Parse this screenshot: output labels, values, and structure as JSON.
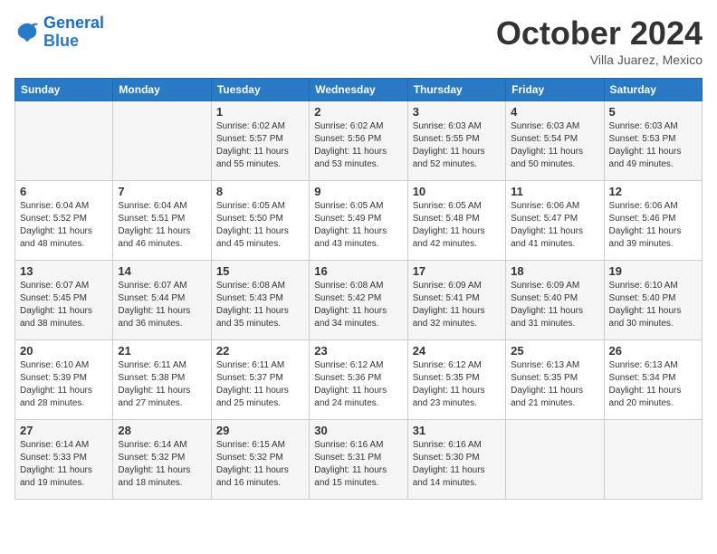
{
  "header": {
    "logo_line1": "General",
    "logo_line2": "Blue",
    "month": "October 2024",
    "location": "Villa Juarez, Mexico"
  },
  "weekdays": [
    "Sunday",
    "Monday",
    "Tuesday",
    "Wednesday",
    "Thursday",
    "Friday",
    "Saturday"
  ],
  "weeks": [
    [
      {
        "day": "",
        "info": ""
      },
      {
        "day": "",
        "info": ""
      },
      {
        "day": "1",
        "info": "Sunrise: 6:02 AM\nSunset: 5:57 PM\nDaylight: 11 hours\nand 55 minutes."
      },
      {
        "day": "2",
        "info": "Sunrise: 6:02 AM\nSunset: 5:56 PM\nDaylight: 11 hours\nand 53 minutes."
      },
      {
        "day": "3",
        "info": "Sunrise: 6:03 AM\nSunset: 5:55 PM\nDaylight: 11 hours\nand 52 minutes."
      },
      {
        "day": "4",
        "info": "Sunrise: 6:03 AM\nSunset: 5:54 PM\nDaylight: 11 hours\nand 50 minutes."
      },
      {
        "day": "5",
        "info": "Sunrise: 6:03 AM\nSunset: 5:53 PM\nDaylight: 11 hours\nand 49 minutes."
      }
    ],
    [
      {
        "day": "6",
        "info": "Sunrise: 6:04 AM\nSunset: 5:52 PM\nDaylight: 11 hours\nand 48 minutes."
      },
      {
        "day": "7",
        "info": "Sunrise: 6:04 AM\nSunset: 5:51 PM\nDaylight: 11 hours\nand 46 minutes."
      },
      {
        "day": "8",
        "info": "Sunrise: 6:05 AM\nSunset: 5:50 PM\nDaylight: 11 hours\nand 45 minutes."
      },
      {
        "day": "9",
        "info": "Sunrise: 6:05 AM\nSunset: 5:49 PM\nDaylight: 11 hours\nand 43 minutes."
      },
      {
        "day": "10",
        "info": "Sunrise: 6:05 AM\nSunset: 5:48 PM\nDaylight: 11 hours\nand 42 minutes."
      },
      {
        "day": "11",
        "info": "Sunrise: 6:06 AM\nSunset: 5:47 PM\nDaylight: 11 hours\nand 41 minutes."
      },
      {
        "day": "12",
        "info": "Sunrise: 6:06 AM\nSunset: 5:46 PM\nDaylight: 11 hours\nand 39 minutes."
      }
    ],
    [
      {
        "day": "13",
        "info": "Sunrise: 6:07 AM\nSunset: 5:45 PM\nDaylight: 11 hours\nand 38 minutes."
      },
      {
        "day": "14",
        "info": "Sunrise: 6:07 AM\nSunset: 5:44 PM\nDaylight: 11 hours\nand 36 minutes."
      },
      {
        "day": "15",
        "info": "Sunrise: 6:08 AM\nSunset: 5:43 PM\nDaylight: 11 hours\nand 35 minutes."
      },
      {
        "day": "16",
        "info": "Sunrise: 6:08 AM\nSunset: 5:42 PM\nDaylight: 11 hours\nand 34 minutes."
      },
      {
        "day": "17",
        "info": "Sunrise: 6:09 AM\nSunset: 5:41 PM\nDaylight: 11 hours\nand 32 minutes."
      },
      {
        "day": "18",
        "info": "Sunrise: 6:09 AM\nSunset: 5:40 PM\nDaylight: 11 hours\nand 31 minutes."
      },
      {
        "day": "19",
        "info": "Sunrise: 6:10 AM\nSunset: 5:40 PM\nDaylight: 11 hours\nand 30 minutes."
      }
    ],
    [
      {
        "day": "20",
        "info": "Sunrise: 6:10 AM\nSunset: 5:39 PM\nDaylight: 11 hours\nand 28 minutes."
      },
      {
        "day": "21",
        "info": "Sunrise: 6:11 AM\nSunset: 5:38 PM\nDaylight: 11 hours\nand 27 minutes."
      },
      {
        "day": "22",
        "info": "Sunrise: 6:11 AM\nSunset: 5:37 PM\nDaylight: 11 hours\nand 25 minutes."
      },
      {
        "day": "23",
        "info": "Sunrise: 6:12 AM\nSunset: 5:36 PM\nDaylight: 11 hours\nand 24 minutes."
      },
      {
        "day": "24",
        "info": "Sunrise: 6:12 AM\nSunset: 5:35 PM\nDaylight: 11 hours\nand 23 minutes."
      },
      {
        "day": "25",
        "info": "Sunrise: 6:13 AM\nSunset: 5:35 PM\nDaylight: 11 hours\nand 21 minutes."
      },
      {
        "day": "26",
        "info": "Sunrise: 6:13 AM\nSunset: 5:34 PM\nDaylight: 11 hours\nand 20 minutes."
      }
    ],
    [
      {
        "day": "27",
        "info": "Sunrise: 6:14 AM\nSunset: 5:33 PM\nDaylight: 11 hours\nand 19 minutes."
      },
      {
        "day": "28",
        "info": "Sunrise: 6:14 AM\nSunset: 5:32 PM\nDaylight: 11 hours\nand 18 minutes."
      },
      {
        "day": "29",
        "info": "Sunrise: 6:15 AM\nSunset: 5:32 PM\nDaylight: 11 hours\nand 16 minutes."
      },
      {
        "day": "30",
        "info": "Sunrise: 6:16 AM\nSunset: 5:31 PM\nDaylight: 11 hours\nand 15 minutes."
      },
      {
        "day": "31",
        "info": "Sunrise: 6:16 AM\nSunset: 5:30 PM\nDaylight: 11 hours\nand 14 minutes."
      },
      {
        "day": "",
        "info": ""
      },
      {
        "day": "",
        "info": ""
      }
    ]
  ]
}
